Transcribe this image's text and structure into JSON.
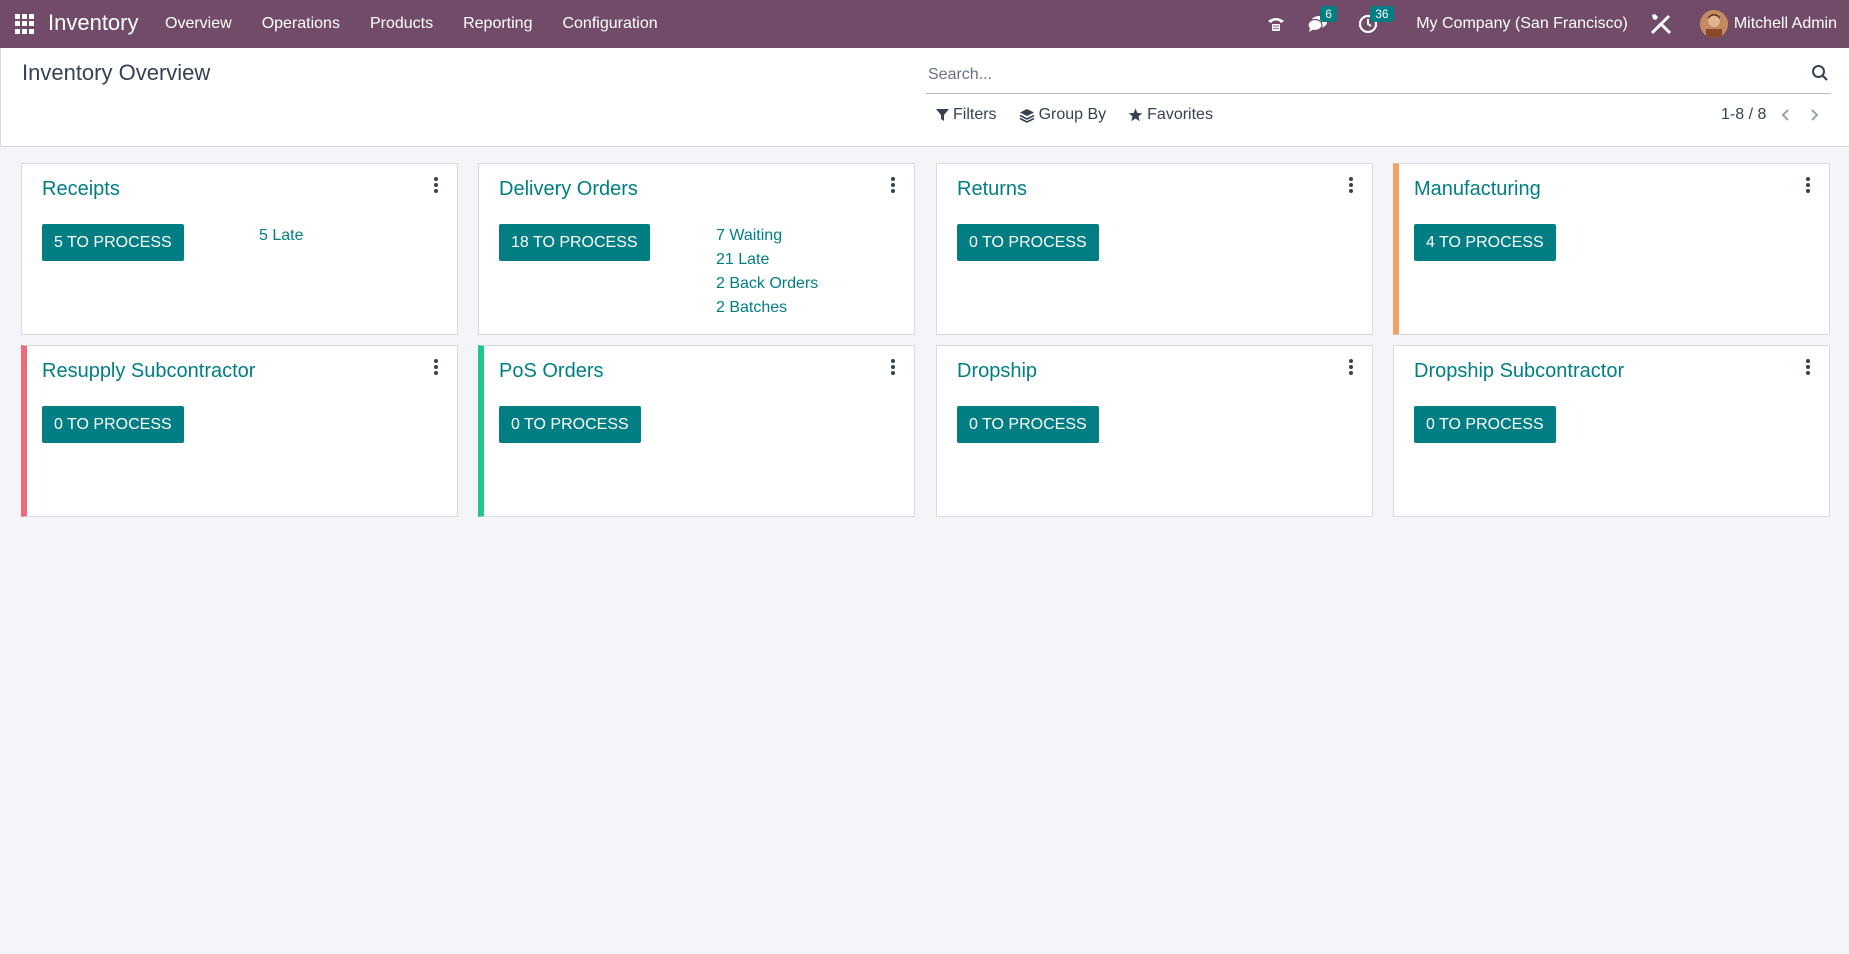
{
  "navbar": {
    "app_name": "Inventory",
    "menu": [
      "Overview",
      "Operations",
      "Products",
      "Reporting",
      "Configuration"
    ],
    "messages_count": "6",
    "activities_count": "36",
    "company": "My Company (San Francisco)",
    "user": "Mitchell Admin",
    "icons": [
      "apps-grid-icon",
      "phone-icon",
      "chat-icon",
      "clock-icon",
      "tools-icon",
      "avatar"
    ]
  },
  "control_panel": {
    "title": "Inventory Overview",
    "search_placeholder": "Search...",
    "filters_label": "Filters",
    "group_by_label": "Group By",
    "favorites_label": "Favorites",
    "pager": "1-8 / 8"
  },
  "colors": {
    "navbar": "#714b67",
    "primary": "#017e84",
    "manufacturing_accent": "#f4a261",
    "resupply_accent": "#f06a7d",
    "pos_accent": "#21c68a"
  },
  "cards": [
    {
      "title": "Receipts",
      "button": "5 TO PROCESS",
      "stats": [
        "5 Late"
      ]
    },
    {
      "title": "Delivery Orders",
      "button": "18 TO PROCESS",
      "stats": [
        "7 Waiting",
        "21 Late",
        "2 Back Orders",
        "2 Batches"
      ]
    },
    {
      "title": "Returns",
      "button": "0 TO PROCESS",
      "stats": []
    },
    {
      "title": "Manufacturing",
      "button": "4 TO PROCESS",
      "stats": []
    },
    {
      "title": "Resupply Subcontractor",
      "button": "0 TO PROCESS",
      "stats": []
    },
    {
      "title": "PoS Orders",
      "button": "0 TO PROCESS",
      "stats": []
    },
    {
      "title": "Dropship",
      "button": "0 TO PROCESS",
      "stats": []
    },
    {
      "title": "Dropship Subcontractor",
      "button": "0 TO PROCESS",
      "stats": []
    }
  ]
}
